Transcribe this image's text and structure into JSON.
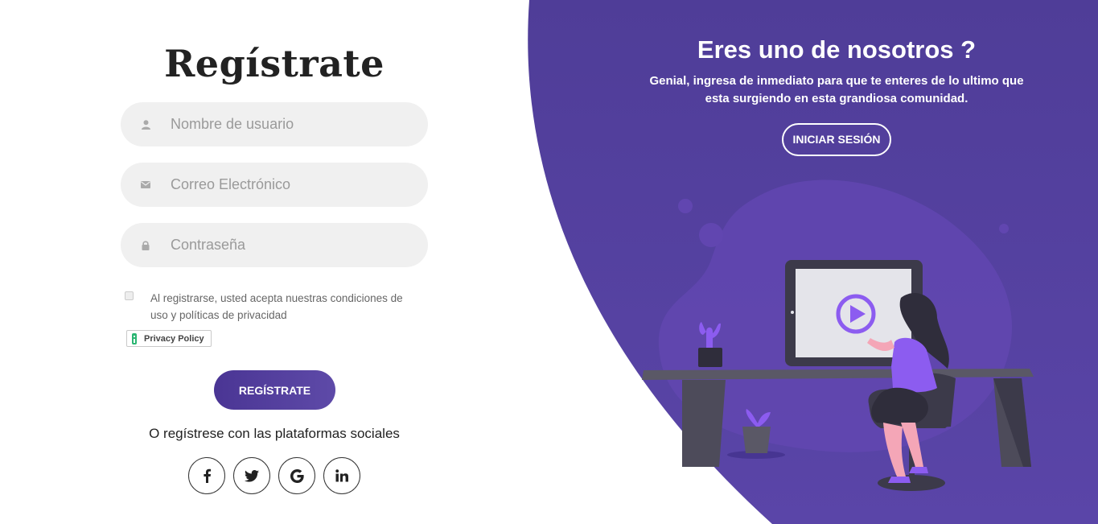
{
  "form": {
    "title": "Regístrate",
    "username_placeholder": "Nombre de usuario",
    "email_placeholder": "Correo Electrónico",
    "password_placeholder": "Contraseña",
    "terms_text": "Al registrarse, usted acepta nuestras condiciones de uso y políticas de privacidad",
    "privacy_badge": "Privacy Policy",
    "submit_label": "REGÍSTRATE",
    "social_label": "O regístrese con las plataformas sociales",
    "social": [
      {
        "name": "facebook",
        "icon": "facebook-icon"
      },
      {
        "name": "twitter",
        "icon": "twitter-icon"
      },
      {
        "name": "google",
        "icon": "google-icon"
      },
      {
        "name": "linkedin",
        "icon": "linkedin-icon"
      }
    ]
  },
  "panel": {
    "title": "Eres uno de nosotros ?",
    "text": "Genial, ingresa de inmediato para que te enteres de lo ultimo que esta surgiendo en esta grandiosa comunidad.",
    "login_label": "INICIAR SESIÓN"
  },
  "colors": {
    "panel_purple": "#4f3c98",
    "button_purple": "#4a3594",
    "field_bg": "#f0f0f0",
    "accent_violet": "#8c5cf0"
  }
}
